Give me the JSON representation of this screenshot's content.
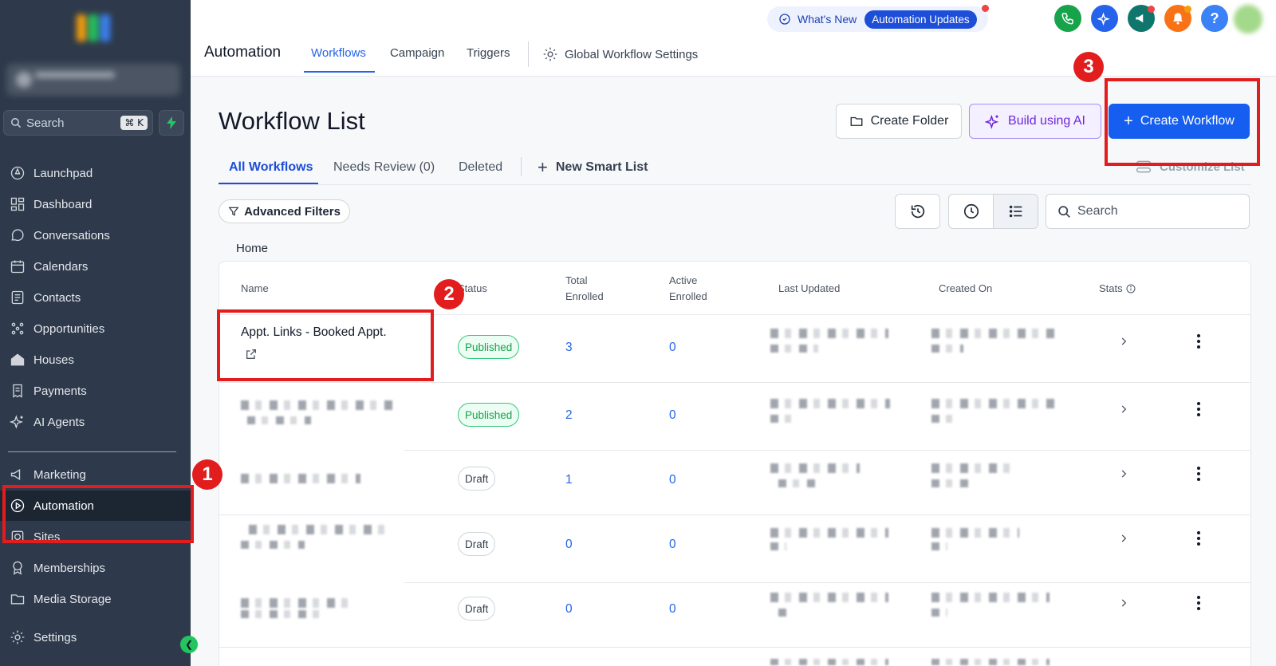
{
  "sidebar": {
    "search_placeholder": "Search",
    "search_shortcut": "⌘ K",
    "items": [
      {
        "label": "Launchpad",
        "icon": "rocket-icon"
      },
      {
        "label": "Dashboard",
        "icon": "dashboard-icon"
      },
      {
        "label": "Conversations",
        "icon": "chat-icon"
      },
      {
        "label": "Calendars",
        "icon": "calendar-icon"
      },
      {
        "label": "Contacts",
        "icon": "contacts-icon"
      },
      {
        "label": "Opportunities",
        "icon": "opportunities-icon"
      },
      {
        "label": "Houses",
        "icon": "house-icon"
      },
      {
        "label": "Payments",
        "icon": "receipt-icon"
      },
      {
        "label": "AI Agents",
        "icon": "sparkle-icon"
      },
      {
        "label": "Marketing",
        "icon": "megaphone-icon"
      },
      {
        "label": "Automation",
        "icon": "play-circle-icon",
        "active": true
      },
      {
        "label": "Sites",
        "icon": "globe-icon"
      },
      {
        "label": "Memberships",
        "icon": "badge-icon"
      },
      {
        "label": "Media Storage",
        "icon": "folder-icon"
      },
      {
        "label": "Settings",
        "icon": "gear-icon"
      }
    ]
  },
  "header": {
    "title": "Automation",
    "tabs": [
      "Workflows",
      "Campaign",
      "Triggers"
    ],
    "settings_label": "Global Workflow Settings",
    "whats_new": "What's New",
    "automation_updates": "Automation Updates"
  },
  "main": {
    "title": "Workflow List",
    "create_folder": "Create Folder",
    "build_ai": "Build using AI",
    "create_workflow": "Create Workflow",
    "subtabs": [
      "All Workflows",
      "Needs Review (0)",
      "Deleted"
    ],
    "new_smart_list": "New Smart List",
    "customize_list": "Customize List",
    "advanced_filters": "Advanced Filters",
    "search_placeholder": "Search",
    "breadcrumb": "Home"
  },
  "table": {
    "headers": {
      "name": "Name",
      "status": "Status",
      "total_1": "Total",
      "total_2": "Enrolled",
      "active_1": "Active",
      "active_2": "Enrolled",
      "last_updated": "Last Updated",
      "created_on": "Created On",
      "stats": "Stats"
    },
    "rows": [
      {
        "name": "Appt. Links - Booked Appt.",
        "status": "Published",
        "total": "3",
        "active": "0"
      },
      {
        "name": "",
        "status": "Published",
        "total": "2",
        "active": "0"
      },
      {
        "name": "",
        "status": "Draft",
        "total": "1",
        "active": "0"
      },
      {
        "name": "",
        "status": "Draft",
        "total": "0",
        "active": "0"
      },
      {
        "name": "",
        "status": "Draft",
        "total": "0",
        "active": "0"
      }
    ]
  },
  "annotations": [
    "1",
    "2",
    "3"
  ],
  "colors": {
    "sidebar_bg": "#2e3a4b",
    "primary": "#155eef",
    "annotation": "#e11d1d",
    "published": "#16a34a"
  }
}
